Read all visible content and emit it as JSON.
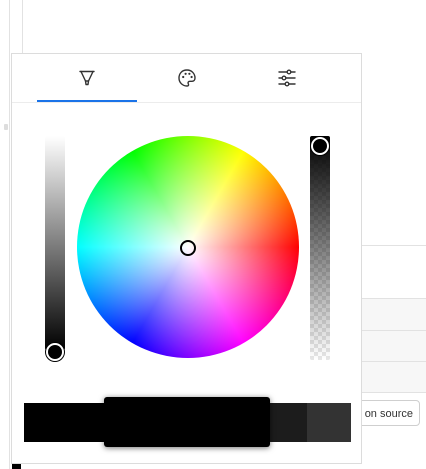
{
  "background": {
    "source_button_label": "on source"
  },
  "picker": {
    "tabs": [
      {
        "name": "tab-brush",
        "icon": "brush-icon"
      },
      {
        "name": "tab-palette",
        "icon": "palette-icon"
      },
      {
        "name": "tab-adjust",
        "icon": "sliders-icon"
      }
    ],
    "selected_tab": "tab-brush",
    "accent_color": "#1a73e8",
    "saturation_value": 0,
    "brightness_value": 1,
    "current_color": "#000000",
    "swatches": [
      "#000000",
      "#000000",
      "#000000",
      "#000000",
      "#1c1c1c",
      "#333333"
    ],
    "active_swatch_index": 2
  }
}
